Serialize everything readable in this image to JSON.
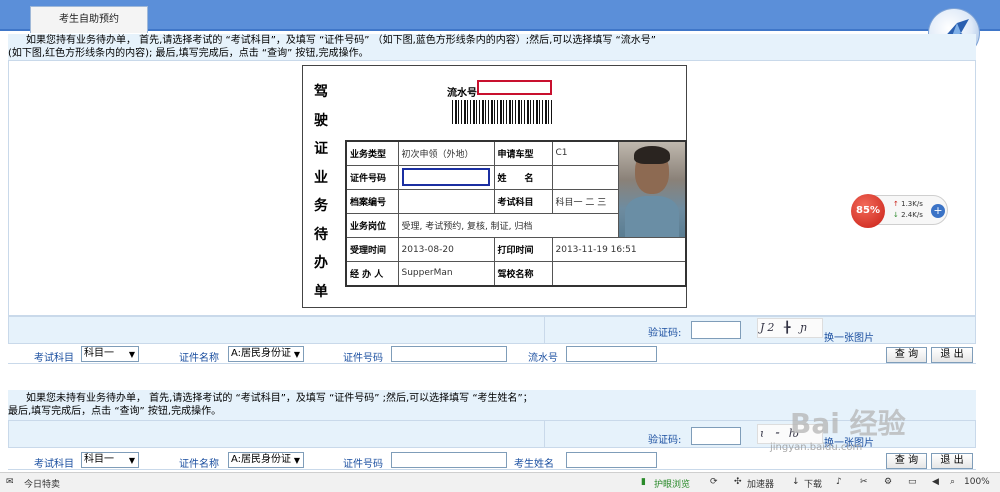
{
  "tab": {
    "label": "考生自助预约"
  },
  "instructions_top": {
    "line1": "如果您持有业务待办单， 首先,请选择考试的 “考试科目”，及填写 “证件号码” （如下图,蓝色方形线条内的内容）;然后,可以选择填写 “流水号”",
    "line2": "(如下图,红色方形线条内的内容); 最后,填写完成后，点击 “查询” 按钮,完成操作。"
  },
  "card": {
    "title_chars": [
      "驾",
      "驶",
      "证",
      "业",
      "务",
      "待",
      "办",
      "单"
    ],
    "serial_label": "流水号",
    "rows": [
      {
        "k1": "业务类型",
        "v1": "初次申领（外地）",
        "k2": "申请车型",
        "v2": "C1"
      },
      {
        "k1": "证件号码",
        "v1": "",
        "k2": "姓　　名",
        "v2": ""
      },
      {
        "k1": "档案编号",
        "v1": "",
        "k2": "考试科目",
        "v2": "科目一 二 三"
      },
      {
        "k1": "业务岗位",
        "v1": "受理, 考试预约, 复核, 制证, 归档",
        "k2": "",
        "v2": ""
      },
      {
        "k1": "受理时间",
        "v1": "2013-08-20",
        "k2": "打印时间",
        "v2": "2013-11-19 16:51"
      },
      {
        "k1": "经 办 人",
        "v1": "SupperMan",
        "k2": "驾校名称",
        "v2": ""
      }
    ]
  },
  "widget": {
    "percent": "85%",
    "up": "1.3K/s",
    "down": "2.4K/s",
    "up_arrow": "↑",
    "down_arrow": "↓",
    "plus": "+"
  },
  "form1": {
    "captcha_label": "验证码:",
    "captcha_text": "J2 ╊ ɲ",
    "refresh_link": "换一张图片",
    "subject_label": "考试科目",
    "subject_value": "科目一",
    "idtype_label": "证件名称",
    "idtype_value": "A:居民身份证",
    "idno_label": "证件号码",
    "serial_label": "流水号",
    "query_btn": "查 询",
    "exit_btn": "退 出"
  },
  "instructions_bottom": {
    "line1": "如果您未持有业务待办单， 首先,请选择考试的 “考试科目”，及填写 “证件号码” ;然后,可以选择填写 “考生姓名”；",
    "line2": "最后,填写完成后，点击 “查询” 按钮,完成操作。"
  },
  "form2": {
    "captcha_label": "验证码:",
    "captcha_text": "ɩ ⁃ ƕ",
    "refresh_link": "换一张图片",
    "subject_label": "考试科目",
    "subject_value": "科目一",
    "idtype_label": "证件名称",
    "idtype_value": "A:居民身份证",
    "idno_label": "证件号码",
    "name_label": "考生姓名",
    "query_btn": "查 询",
    "exit_btn": "退 出"
  },
  "watermark": {
    "main": "Bai 经验",
    "sub": "jingyan.baidu.com"
  },
  "statusbar": {
    "left": "今日特卖",
    "mode": "护眼浏览",
    "accelerator": "加速器",
    "download": "下载",
    "zoom": "100%"
  }
}
